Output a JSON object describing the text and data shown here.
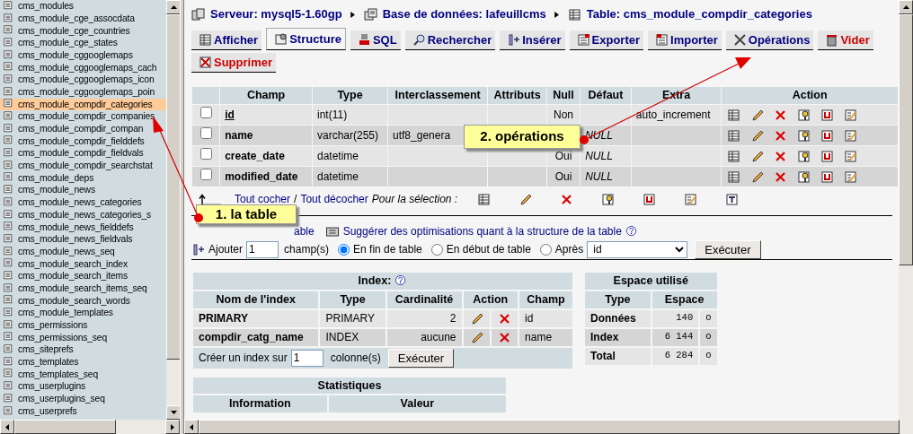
{
  "sidebar": {
    "tables": [
      {
        "name": "cms_modules",
        "selected": false
      },
      {
        "name": "cms_module_cge_assocdata",
        "selected": false
      },
      {
        "name": "cms_module_cge_countries",
        "selected": false
      },
      {
        "name": "cms_module_cge_states",
        "selected": false
      },
      {
        "name": "cms_module_cggooglemaps",
        "selected": false
      },
      {
        "name": "cms_module_cggooglemaps_cach",
        "selected": false
      },
      {
        "name": "cms_module_cggooglemaps_icon",
        "selected": false
      },
      {
        "name": "cms_module_cggooglemaps_poin",
        "selected": false
      },
      {
        "name": "cms_module_compdir_categories",
        "selected": true
      },
      {
        "name": "cms_module_compdir_companies",
        "selected": false
      },
      {
        "name": "cms_module_compdir_compan",
        "selected": false
      },
      {
        "name": "cms_module_compdir_fielddefs",
        "selected": false
      },
      {
        "name": "cms_module_compdir_fieldvals",
        "selected": false
      },
      {
        "name": "cms_module_compdir_searchstat",
        "selected": false
      },
      {
        "name": "cms_module_deps",
        "selected": false
      },
      {
        "name": "cms_module_news",
        "selected": false
      },
      {
        "name": "cms_module_news_categories",
        "selected": false
      },
      {
        "name": "cms_module_news_categories_s",
        "selected": false
      },
      {
        "name": "cms_module_news_fielddefs",
        "selected": false
      },
      {
        "name": "cms_module_news_fieldvals",
        "selected": false
      },
      {
        "name": "cms_module_news_seq",
        "selected": false
      },
      {
        "name": "cms_module_search_index",
        "selected": false
      },
      {
        "name": "cms_module_search_items",
        "selected": false
      },
      {
        "name": "cms_module_search_items_seq",
        "selected": false
      },
      {
        "name": "cms_module_search_words",
        "selected": false
      },
      {
        "name": "cms_module_templates",
        "selected": false
      },
      {
        "name": "cms_permissions",
        "selected": false
      },
      {
        "name": "cms_permissions_seq",
        "selected": false
      },
      {
        "name": "cms_siteprefs",
        "selected": false
      },
      {
        "name": "cms_templates",
        "selected": false
      },
      {
        "name": "cms_templates_seq",
        "selected": false
      },
      {
        "name": "cms_userplugins",
        "selected": false
      },
      {
        "name": "cms_userplugins_seq",
        "selected": false
      },
      {
        "name": "cms_userprefs",
        "selected": false
      }
    ]
  },
  "breadcrumb": [
    {
      "kind": "server",
      "label": "Serveur: mysql5-1.60gp"
    },
    {
      "kind": "database",
      "label": "Base de données: lafeuillcms"
    },
    {
      "kind": "table",
      "label": "Table: cms_module_compdir_categories"
    }
  ],
  "tabs": [
    {
      "kind": "browse",
      "label": "Afficher",
      "selected": false,
      "danger": false
    },
    {
      "kind": "structure",
      "label": "Structure",
      "selected": true,
      "danger": false
    },
    {
      "kind": "sql",
      "label": "SQL",
      "selected": false,
      "danger": false
    },
    {
      "kind": "search",
      "label": "Rechercher",
      "selected": false,
      "danger": false
    },
    {
      "kind": "insert",
      "label": "Insérer",
      "selected": false,
      "danger": false
    },
    {
      "kind": "export",
      "label": "Exporter",
      "selected": false,
      "danger": false
    },
    {
      "kind": "import",
      "label": "Importer",
      "selected": false,
      "danger": false
    },
    {
      "kind": "operations",
      "label": "Opérations",
      "selected": false,
      "danger": false
    },
    {
      "kind": "empty",
      "label": "Vider",
      "selected": false,
      "danger": true
    },
    {
      "kind": "drop",
      "label": "Supprimer",
      "selected": false,
      "danger": true
    }
  ],
  "structure": {
    "columns": [
      "Champ",
      "Type",
      "Interclassement",
      "Attributs",
      "Null",
      "Défaut",
      "Extra",
      "Action"
    ],
    "rows": [
      {
        "checked": false,
        "field": "id",
        "primary": true,
        "type": "int(11)",
        "null": "Non",
        "extra": "auto_increment"
      },
      {
        "checked": false,
        "field": "name",
        "primary": false,
        "type": "varchar(255)",
        "collation": "utf8_genera",
        "default": "NULL"
      },
      {
        "checked": false,
        "field": "create_date",
        "primary": false,
        "type": "datetime",
        "null": "Oui",
        "default": "NULL"
      },
      {
        "checked": false,
        "field": "modified_date",
        "primary": false,
        "type": "datetime",
        "null": "Oui",
        "default": "NULL"
      }
    ],
    "check_all": "Tout cocher",
    "separator": "/",
    "uncheck_all": "Tout décocher",
    "with_selected": "Pour la sélection :"
  },
  "links": [
    {
      "kind": "plain",
      "label": "able"
    },
    {
      "kind": "propose",
      "label": "Suggérer des optimisations quant à la structure de la table"
    }
  ],
  "add_fields": {
    "label": "Ajouter",
    "count": "1",
    "unit": "champ(s)",
    "positions": [
      {
        "label": "En fin de table",
        "selected": true
      },
      {
        "label": "En début de table",
        "selected": false
      },
      {
        "label": "Après",
        "selected": false
      }
    ],
    "after_field": "id",
    "button": "Exécuter"
  },
  "indexes": {
    "title": "Index:",
    "columns": [
      "Nom de l'index",
      "Type",
      "Cardinalité",
      "Action",
      "Champ"
    ],
    "rows": [
      {
        "name": "PRIMARY",
        "type": "PRIMARY",
        "cardinality": "2",
        "field": "id"
      },
      {
        "name": "compdir_catg_name",
        "type": "INDEX",
        "cardinality": "aucune",
        "field": "name"
      }
    ],
    "create_label": "Créer un index sur",
    "create_count": "1",
    "create_unit": "colonne(s)",
    "button": "Exécuter"
  },
  "space": {
    "title": "Espace utilisé",
    "columns": [
      "Type",
      "Espace"
    ],
    "rows": [
      {
        "type": "Données",
        "value": "140",
        "unit": "o"
      },
      {
        "type": "Index",
        "value": "6 144",
        "unit": "o"
      },
      {
        "type": "Total",
        "value": "6 284",
        "unit": "o"
      }
    ]
  },
  "statistics": {
    "title": "Statistiques",
    "columns": [
      "Information",
      "Valeur"
    ]
  },
  "callouts": [
    {
      "label": "1. la table"
    },
    {
      "label": "2. opérations"
    }
  ]
}
